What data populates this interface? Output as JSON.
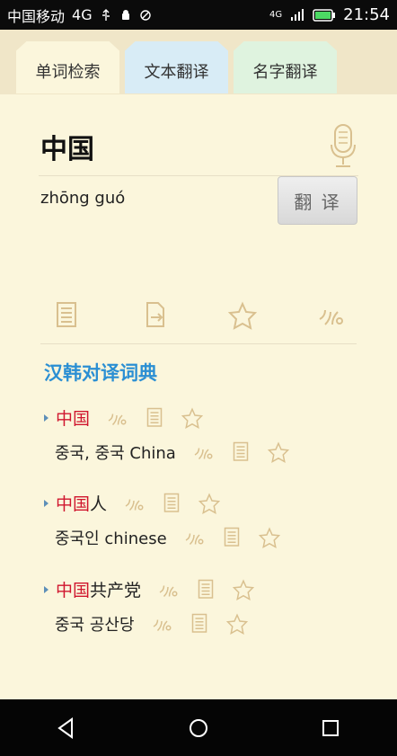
{
  "status": {
    "carrier": "中国移动",
    "network": "4G",
    "time": "21:54",
    "signal_label": "4G"
  },
  "tabs": [
    {
      "label": "单词检索"
    },
    {
      "label": "文本翻译"
    },
    {
      "label": "名字翻译"
    }
  ],
  "search": {
    "value": "中国",
    "pinyin": "zhōng guó"
  },
  "translate_button": {
    "label": "翻 译"
  },
  "dictionary": {
    "title": "汉韩对译词典",
    "entries": [
      {
        "head_highlight": "中国",
        "head_rest": "",
        "translation": "중국, 중국 China"
      },
      {
        "head_highlight": "中国",
        "head_rest": "人",
        "translation": "중국인 chinese"
      },
      {
        "head_highlight": "中国",
        "head_rest": "共产党",
        "translation": "중국 공산당"
      }
    ]
  },
  "colors": {
    "accent_blue": "#2b8fd3",
    "highlight_red": "#d0162e",
    "icon_gold": "#d9c08f"
  }
}
